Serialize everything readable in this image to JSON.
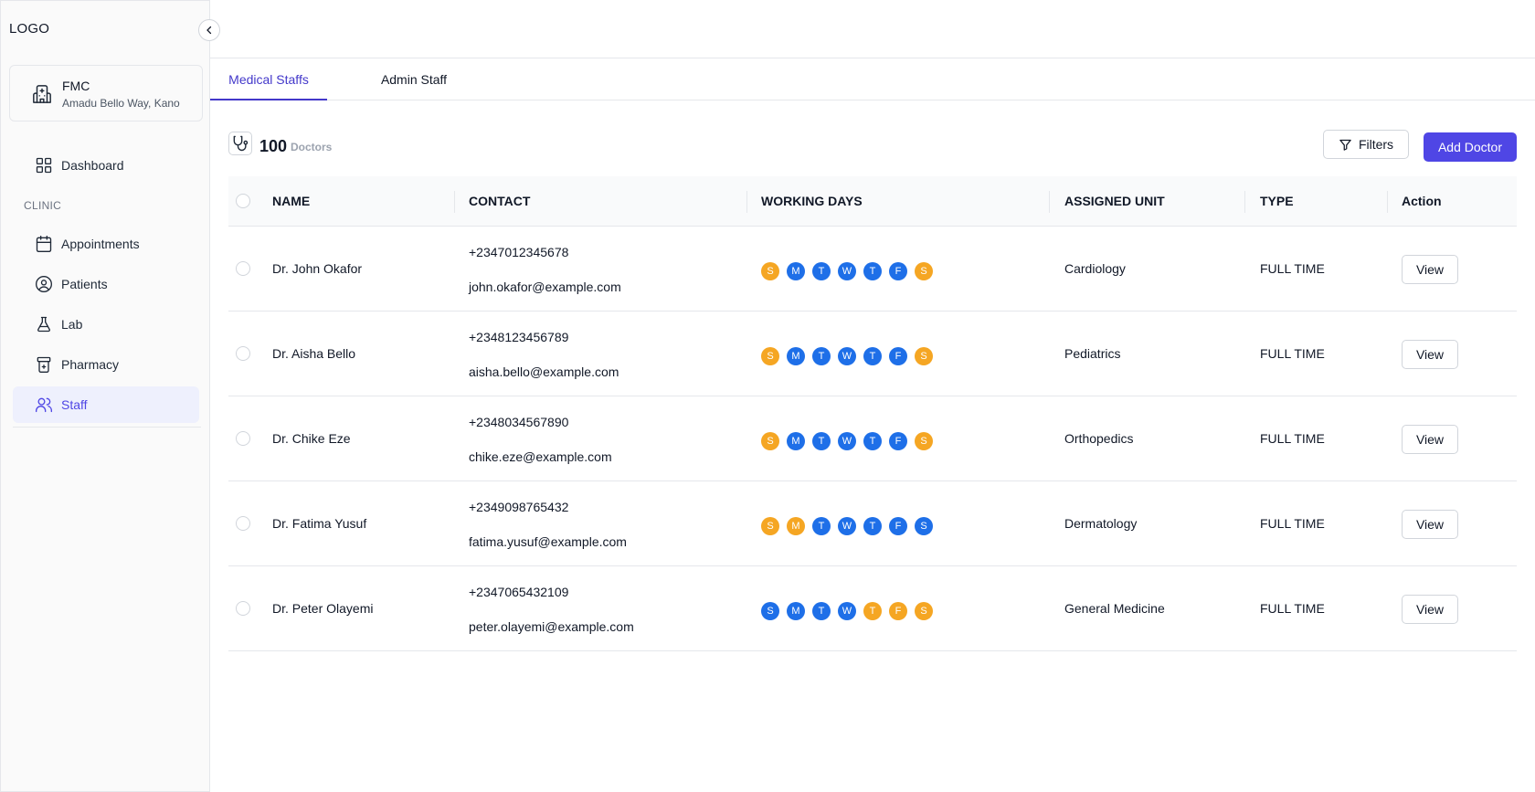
{
  "sidebar": {
    "logo": "LOGO",
    "facility": {
      "name": "FMC",
      "address": "Amadu Bello Way, Kano"
    },
    "section_label": "CLINIC",
    "items": [
      {
        "label": "Dashboard",
        "icon": "grid-icon"
      },
      {
        "label": "Appointments",
        "icon": "calendar-icon"
      },
      {
        "label": "Patients",
        "icon": "user-circle-icon"
      },
      {
        "label": "Lab",
        "icon": "flask-icon"
      },
      {
        "label": "Pharmacy",
        "icon": "pill-bottle-icon"
      },
      {
        "label": "Staff",
        "icon": "users-icon",
        "active": true
      }
    ]
  },
  "tabs": [
    {
      "label": "Medical Staffs",
      "active": true
    },
    {
      "label": "Admin Staff",
      "active": false
    }
  ],
  "summary": {
    "count": "100",
    "count_label": "Doctors"
  },
  "actions": {
    "filters_label": "Filters",
    "add_label": "Add Doctor"
  },
  "table": {
    "headers": [
      "NAME",
      "CONTACT",
      "WORKING DAYS",
      "ASSIGNED UNIT",
      "TYPE",
      "Action"
    ],
    "view_label": "View",
    "rows": [
      {
        "name": "Dr. John Okafor",
        "phone": "+2347012345678",
        "email": "john.okafor@example.com",
        "unit": "Cardiology",
        "type": "FULL TIME",
        "days": [
          [
            "S",
            "off"
          ],
          [
            "M",
            "on"
          ],
          [
            "T",
            "on"
          ],
          [
            "W",
            "on"
          ],
          [
            "T",
            "on"
          ],
          [
            "F",
            "on"
          ],
          [
            "S",
            "off"
          ]
        ]
      },
      {
        "name": "Dr. Aisha Bello",
        "phone": "+2348123456789",
        "email": "aisha.bello@example.com",
        "unit": "Pediatrics",
        "type": "FULL TIME",
        "days": [
          [
            "S",
            "off"
          ],
          [
            "M",
            "on"
          ],
          [
            "T",
            "on"
          ],
          [
            "W",
            "on"
          ],
          [
            "T",
            "on"
          ],
          [
            "F",
            "on"
          ],
          [
            "S",
            "off"
          ]
        ]
      },
      {
        "name": "Dr. Chike Eze",
        "phone": "+2348034567890",
        "email": "chike.eze@example.com",
        "unit": "Orthopedics",
        "type": "FULL TIME",
        "days": [
          [
            "S",
            "off"
          ],
          [
            "M",
            "on"
          ],
          [
            "T",
            "on"
          ],
          [
            "W",
            "on"
          ],
          [
            "T",
            "on"
          ],
          [
            "F",
            "on"
          ],
          [
            "S",
            "off"
          ]
        ]
      },
      {
        "name": "Dr. Fatima Yusuf",
        "phone": "+2349098765432",
        "email": "fatima.yusuf@example.com",
        "unit": "Dermatology",
        "type": "FULL TIME",
        "days": [
          [
            "S",
            "off"
          ],
          [
            "M",
            "off"
          ],
          [
            "T",
            "on"
          ],
          [
            "W",
            "on"
          ],
          [
            "T",
            "on"
          ],
          [
            "F",
            "on"
          ],
          [
            "S",
            "on"
          ]
        ]
      },
      {
        "name": "Dr. Peter Olayemi",
        "phone": "+2347065432109",
        "email": "peter.olayemi@example.com",
        "unit": "General Medicine",
        "type": "FULL TIME",
        "days": [
          [
            "S",
            "on"
          ],
          [
            "M",
            "on"
          ],
          [
            "T",
            "on"
          ],
          [
            "W",
            "on"
          ],
          [
            "T",
            "off"
          ],
          [
            "F",
            "off"
          ],
          [
            "S",
            "off"
          ]
        ]
      }
    ]
  },
  "colors": {
    "accent": "#4f46e5",
    "day_on": "#1e6fe8",
    "day_off": "#f5a623"
  }
}
